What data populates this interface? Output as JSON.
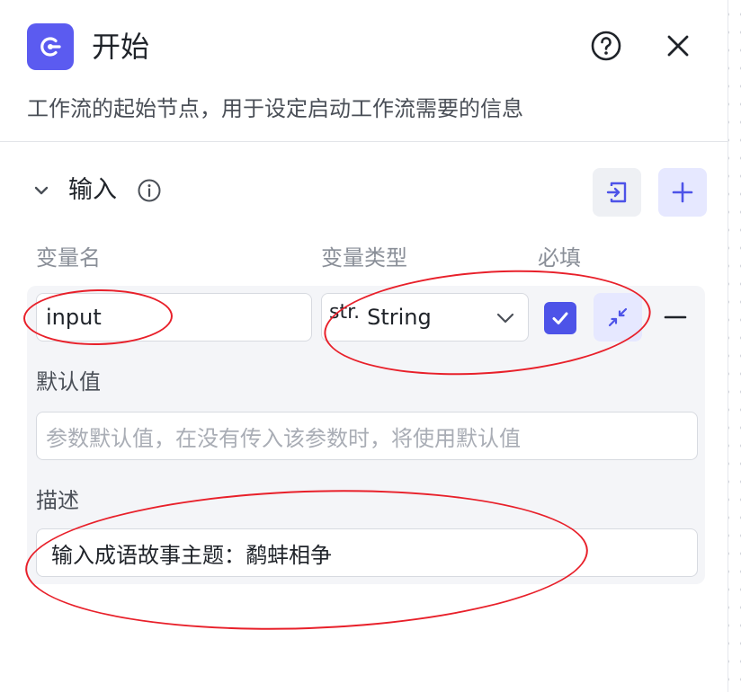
{
  "header": {
    "title": "开始",
    "description": "工作流的起始节点，用于设定启动工作流需要的信息"
  },
  "section": {
    "title": "输入"
  },
  "columns": {
    "name": "变量名",
    "type": "变量类型",
    "required": "必填"
  },
  "variable": {
    "name": "input",
    "type_prefix": "str.",
    "type": "String",
    "required": true,
    "default_label": "默认值",
    "default_placeholder": "参数默认值，在没有传入该参数时，将使用默认值",
    "description_label": "描述",
    "description_value": "输入成语故事主题：鹬蚌相争"
  },
  "colors": {
    "accent": "#4d53e8",
    "logo": "#5b5bf0",
    "annotation": "#e8202a"
  },
  "icons": {
    "logo": "start-node-icon",
    "help": "help-circle-icon",
    "close": "close-icon",
    "toggle": "chevron-down-icon",
    "info": "info-icon",
    "import": "import-icon",
    "add": "plus-icon",
    "select": "chevron-down-icon",
    "check": "check-icon",
    "collapse": "collapse-arrows-icon",
    "remove": "minus-icon"
  }
}
